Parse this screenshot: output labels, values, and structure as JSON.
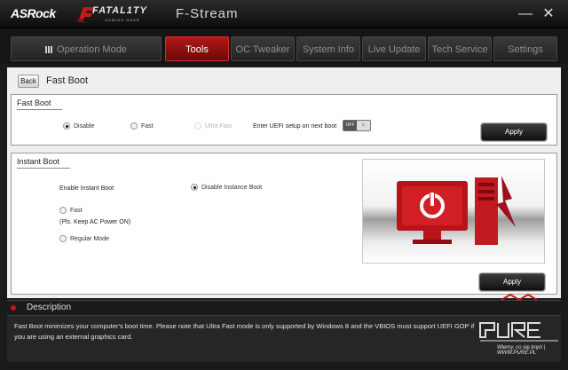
{
  "window": {
    "brand": "ASRock",
    "logo_main": "FATAL1TY",
    "logo_sub": "GAMING GEAR",
    "app_title": "F-Stream",
    "minimize_icon": "minimize-icon",
    "close_icon": "close-icon"
  },
  "tabs": [
    {
      "label": "Operation Mode",
      "icon": "grid-icon"
    },
    {
      "label": "Tools",
      "active": true
    },
    {
      "label": "OC Tweaker"
    },
    {
      "label": "System Info"
    },
    {
      "label": "Live Update"
    },
    {
      "label": "Tech Service"
    },
    {
      "label": "Settings"
    }
  ],
  "breadcrumb": {
    "back": "Back",
    "title": "Fast Boot"
  },
  "fast_boot": {
    "title": "Fast Boot",
    "options": [
      {
        "label": "Disable",
        "selected": true
      },
      {
        "label": "Fast",
        "selected": false
      },
      {
        "label": "Ultra Fast",
        "selected": false,
        "disabled": true
      }
    ],
    "uefi_label": "Enter UEFI setup on next boot",
    "uefi_toggle": "OFF",
    "apply": "Apply"
  },
  "instant_boot": {
    "title": "Instant Boot",
    "enable_label": "Enable Instant Boot",
    "disable_option": {
      "label": "Disable Instance Boot",
      "selected": true
    },
    "fast_option": {
      "label": "Fast",
      "selected": false
    },
    "fast_note": "(Pls. Keep AC Power ON)",
    "regular_option": {
      "label": "Regular Mode",
      "selected": false
    },
    "apply": "Apply",
    "illustration": "pc-power-illustration"
  },
  "description": {
    "title": "Description",
    "text": "Fast Boot minimizes your computer's boot time. Please note that Ultra Fast mode is only supported by Windows 8 and the VBIOS must support UEFI GOP if you are using an external graphics card."
  },
  "watermark": {
    "text": "Wiemy, co się kręci | WWW.PURE.PL"
  },
  "colors": {
    "accent": "#b01919",
    "background": "#1a1a1a",
    "panel": "#ffffff"
  }
}
